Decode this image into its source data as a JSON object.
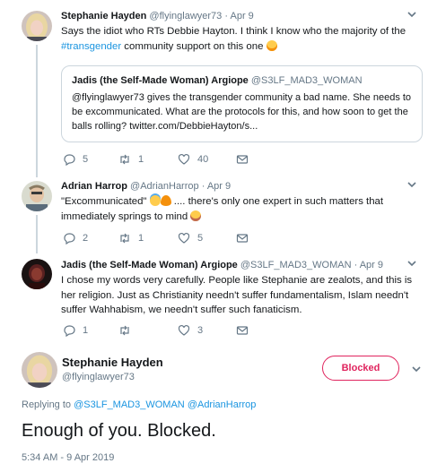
{
  "tweets": [
    {
      "display_name": "Stephanie Hayden",
      "handle": "@flyinglawyer73",
      "separator": "·",
      "time": "Apr 9",
      "text_before": "Says the idiot who RTs Debbie Hayton. I think I know who the majority of the ",
      "hashtag": "#transgender",
      "text_after": " community support on this one",
      "emoji": "tears-of-joy",
      "quote": {
        "display_name": "Jadis (the Self-Made Woman) Argiope",
        "handle": "@S3LF_MAD3_WOMAN",
        "text": "@flyinglawyer73 gives the transgender community a bad name. She needs to be excommunicated. What are the protocols for this, and how soon to get the balls rolling? twitter.com/DebbieHayton/s..."
      },
      "replies": "5",
      "retweets": "1",
      "likes": "40"
    },
    {
      "display_name": "Adrian Harrop",
      "handle": "@AdrianHarrop",
      "separator": "·",
      "time": "Apr 9",
      "text_open": "\"Excommunicated\"",
      "text_rest": " .... there's only one expert in such matters that immediately springs to mind",
      "emojis": [
        "halo-face",
        "fire",
        "smirk-face"
      ],
      "replies": "2",
      "retweets": "1",
      "likes": "5"
    },
    {
      "display_name": "Jadis (the Self-Made Woman) Argiope",
      "handle": "@S3LF_MAD3_WOMAN",
      "separator": "·",
      "time": "Apr 9",
      "text": "I chose my words very carefully. People like Stephanie are zealots, and this is her religion. Just as Christianity needn't suffer fundamentalism, Islam needn't suffer Wahhabism, we needn't suffer such fanaticism.",
      "replies": "1",
      "retweets": "",
      "likes": "3"
    }
  ],
  "main": {
    "display_name": "Stephanie Hayden",
    "handle": "@flyinglawyer73",
    "blocked_label": "Blocked",
    "replying_label": "Replying to",
    "mention_1": "@S3LF_MAD3_WOMAN",
    "mention_2": "@AdrianHarrop",
    "text": "Enough of you. Blocked.",
    "timestamp": "5:34 AM - 9 Apr 2019"
  },
  "colors": {
    "link": "#1b95e0",
    "muted": "#657786",
    "border": "#ccd6dd",
    "blocked": "#e0245e"
  },
  "icons": [
    "reply-icon",
    "retweet-icon",
    "like-icon",
    "message-icon",
    "chevron-down-icon"
  ]
}
